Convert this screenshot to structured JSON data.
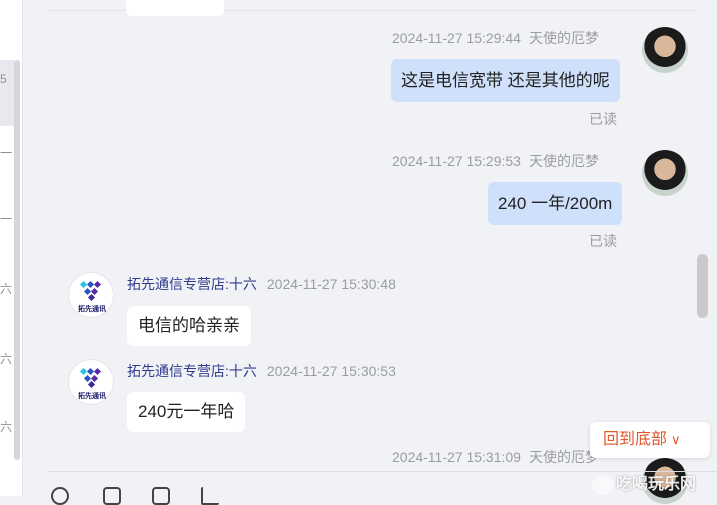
{
  "left_panel": {
    "chars": [
      "5",
      "一",
      "一",
      "六",
      "六",
      "六"
    ]
  },
  "messages": [
    {
      "side": "right",
      "timestamp": "2024-11-27 15:29:44",
      "nickname": "天使的厄梦",
      "text": "这是电信宽带 还是其他的呢",
      "status": "已读"
    },
    {
      "side": "right",
      "timestamp": "2024-11-27 15:29:53",
      "nickname": "天使的厄梦",
      "text": "240 一年/200m",
      "status": "已读"
    },
    {
      "side": "left",
      "shop": "拓先通信专营店:十六",
      "timestamp": "2024-11-27 15:30:48",
      "text": "电信的哈亲亲"
    },
    {
      "side": "left",
      "shop": "拓先通信专营店:十六",
      "timestamp": "2024-11-27 15:30:53",
      "text": "240元一年哈"
    },
    {
      "side": "right",
      "timestamp": "2024-11-27 15:31:09",
      "nickname": "天使的厄梦"
    }
  ],
  "shop_avatar_text": "拓先通讯",
  "back_to_bottom": {
    "label": "回到底部",
    "icon": "chevron-down-icon",
    "color": "#e1572d"
  },
  "watermark": "吃喝玩乐网",
  "colors": {
    "bubble_self": "#cfe0fb",
    "bubble_other": "#ffffff",
    "background": "#f1f2f6",
    "shop_name": "#2f3c8d"
  }
}
